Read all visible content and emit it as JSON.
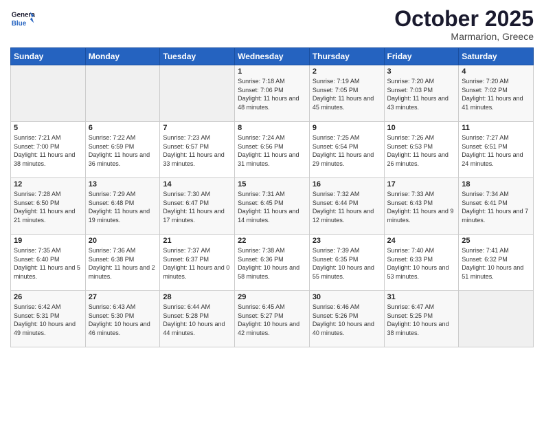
{
  "header": {
    "logo_line1": "General",
    "logo_line2": "Blue",
    "month": "October 2025",
    "location": "Marmarion, Greece"
  },
  "days_of_week": [
    "Sunday",
    "Monday",
    "Tuesday",
    "Wednesday",
    "Thursday",
    "Friday",
    "Saturday"
  ],
  "weeks": [
    [
      {
        "day": "",
        "content": ""
      },
      {
        "day": "",
        "content": ""
      },
      {
        "day": "",
        "content": ""
      },
      {
        "day": "1",
        "content": "Sunrise: 7:18 AM\nSunset: 7:06 PM\nDaylight: 11 hours and 48 minutes."
      },
      {
        "day": "2",
        "content": "Sunrise: 7:19 AM\nSunset: 7:05 PM\nDaylight: 11 hours and 45 minutes."
      },
      {
        "day": "3",
        "content": "Sunrise: 7:20 AM\nSunset: 7:03 PM\nDaylight: 11 hours and 43 minutes."
      },
      {
        "day": "4",
        "content": "Sunrise: 7:20 AM\nSunset: 7:02 PM\nDaylight: 11 hours and 41 minutes."
      }
    ],
    [
      {
        "day": "5",
        "content": "Sunrise: 7:21 AM\nSunset: 7:00 PM\nDaylight: 11 hours and 38 minutes."
      },
      {
        "day": "6",
        "content": "Sunrise: 7:22 AM\nSunset: 6:59 PM\nDaylight: 11 hours and 36 minutes."
      },
      {
        "day": "7",
        "content": "Sunrise: 7:23 AM\nSunset: 6:57 PM\nDaylight: 11 hours and 33 minutes."
      },
      {
        "day": "8",
        "content": "Sunrise: 7:24 AM\nSunset: 6:56 PM\nDaylight: 11 hours and 31 minutes."
      },
      {
        "day": "9",
        "content": "Sunrise: 7:25 AM\nSunset: 6:54 PM\nDaylight: 11 hours and 29 minutes."
      },
      {
        "day": "10",
        "content": "Sunrise: 7:26 AM\nSunset: 6:53 PM\nDaylight: 11 hours and 26 minutes."
      },
      {
        "day": "11",
        "content": "Sunrise: 7:27 AM\nSunset: 6:51 PM\nDaylight: 11 hours and 24 minutes."
      }
    ],
    [
      {
        "day": "12",
        "content": "Sunrise: 7:28 AM\nSunset: 6:50 PM\nDaylight: 11 hours and 21 minutes."
      },
      {
        "day": "13",
        "content": "Sunrise: 7:29 AM\nSunset: 6:48 PM\nDaylight: 11 hours and 19 minutes."
      },
      {
        "day": "14",
        "content": "Sunrise: 7:30 AM\nSunset: 6:47 PM\nDaylight: 11 hours and 17 minutes."
      },
      {
        "day": "15",
        "content": "Sunrise: 7:31 AM\nSunset: 6:45 PM\nDaylight: 11 hours and 14 minutes."
      },
      {
        "day": "16",
        "content": "Sunrise: 7:32 AM\nSunset: 6:44 PM\nDaylight: 11 hours and 12 minutes."
      },
      {
        "day": "17",
        "content": "Sunrise: 7:33 AM\nSunset: 6:43 PM\nDaylight: 11 hours and 9 minutes."
      },
      {
        "day": "18",
        "content": "Sunrise: 7:34 AM\nSunset: 6:41 PM\nDaylight: 11 hours and 7 minutes."
      }
    ],
    [
      {
        "day": "19",
        "content": "Sunrise: 7:35 AM\nSunset: 6:40 PM\nDaylight: 11 hours and 5 minutes."
      },
      {
        "day": "20",
        "content": "Sunrise: 7:36 AM\nSunset: 6:38 PM\nDaylight: 11 hours and 2 minutes."
      },
      {
        "day": "21",
        "content": "Sunrise: 7:37 AM\nSunset: 6:37 PM\nDaylight: 11 hours and 0 minutes."
      },
      {
        "day": "22",
        "content": "Sunrise: 7:38 AM\nSunset: 6:36 PM\nDaylight: 10 hours and 58 minutes."
      },
      {
        "day": "23",
        "content": "Sunrise: 7:39 AM\nSunset: 6:35 PM\nDaylight: 10 hours and 55 minutes."
      },
      {
        "day": "24",
        "content": "Sunrise: 7:40 AM\nSunset: 6:33 PM\nDaylight: 10 hours and 53 minutes."
      },
      {
        "day": "25",
        "content": "Sunrise: 7:41 AM\nSunset: 6:32 PM\nDaylight: 10 hours and 51 minutes."
      }
    ],
    [
      {
        "day": "26",
        "content": "Sunrise: 6:42 AM\nSunset: 5:31 PM\nDaylight: 10 hours and 49 minutes."
      },
      {
        "day": "27",
        "content": "Sunrise: 6:43 AM\nSunset: 5:30 PM\nDaylight: 10 hours and 46 minutes."
      },
      {
        "day": "28",
        "content": "Sunrise: 6:44 AM\nSunset: 5:28 PM\nDaylight: 10 hours and 44 minutes."
      },
      {
        "day": "29",
        "content": "Sunrise: 6:45 AM\nSunset: 5:27 PM\nDaylight: 10 hours and 42 minutes."
      },
      {
        "day": "30",
        "content": "Sunrise: 6:46 AM\nSunset: 5:26 PM\nDaylight: 10 hours and 40 minutes."
      },
      {
        "day": "31",
        "content": "Sunrise: 6:47 AM\nSunset: 5:25 PM\nDaylight: 10 hours and 38 minutes."
      },
      {
        "day": "",
        "content": ""
      }
    ]
  ]
}
